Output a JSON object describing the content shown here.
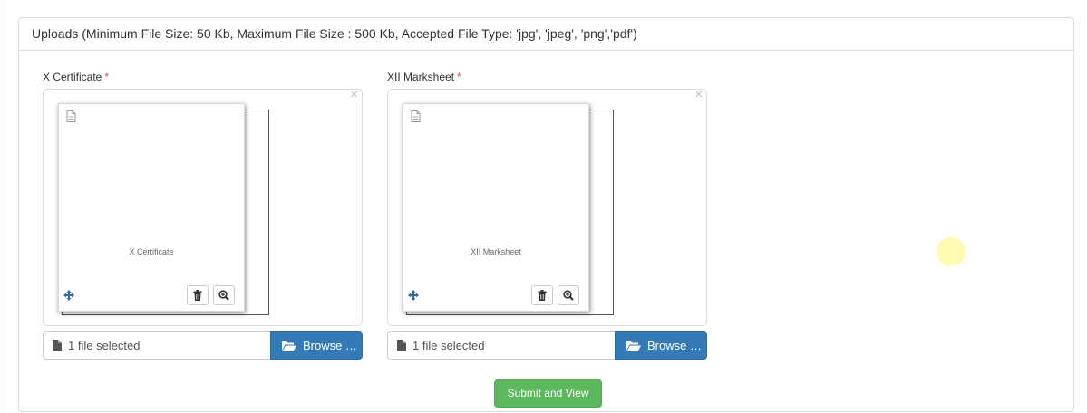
{
  "panel": {
    "heading": "Uploads (Minimum File Size: 50 Kb, Maximum File Size : 500 Kb, Accepted File Type: 'jpg', 'jpeg', 'png','pdf')"
  },
  "uploads": [
    {
      "label": "X Certificate",
      "required_mark": "*",
      "close": "×",
      "caption": "X Certificate",
      "file_status": "1 file selected",
      "browse_label": "Browse …"
    },
    {
      "label": "XII Marksheet",
      "required_mark": "*",
      "close": "×",
      "caption": "XII Marksheet",
      "file_status": "1 file selected",
      "browse_label": "Browse …"
    }
  ],
  "actions": {
    "submit_label": "Submit and View"
  },
  "colors": {
    "primary": "#337ab7",
    "success": "#5cb85c",
    "required": "#d9534f",
    "move_icon": "#2a6fa8"
  },
  "icons": [
    "file-icon",
    "move-icon",
    "trash-icon",
    "zoom-in-icon",
    "folder-open-icon",
    "close-icon"
  ]
}
